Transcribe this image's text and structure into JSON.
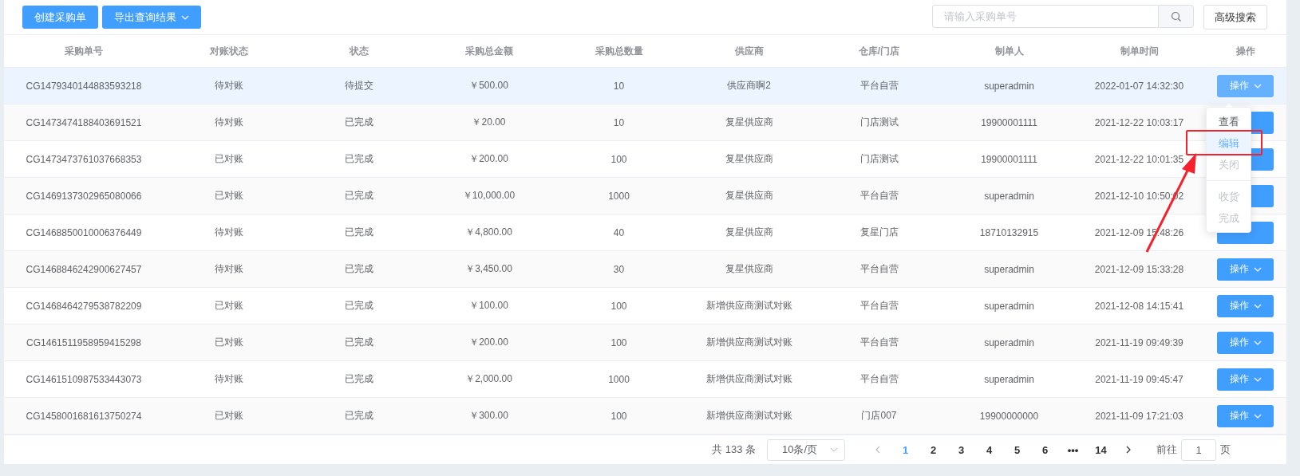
{
  "toolbar": {
    "buttons": [
      {
        "label": "创建采购单",
        "kind": "plain"
      },
      {
        "label": "导出查询结果",
        "kind": "dropdown"
      }
    ],
    "search": {
      "placeholder": "请输入采购单号"
    },
    "advanced_button": "高级搜索"
  },
  "table": {
    "columns": [
      "采购单号",
      "对账状态",
      "状态",
      "采购总金额",
      "采购总数量",
      "供应商",
      "仓库/门店",
      "制单人",
      "制单时间",
      "操作"
    ],
    "rows": [
      {
        "cells": [
          "CG1479340144883593218",
          "待对账",
          "待提交",
          "￥500.00",
          "10",
          "供应商啊2",
          "平台自营",
          "superadmin",
          "2022-01-07 14:32:30"
        ],
        "action": "操作",
        "selected": true
      },
      {
        "cells": [
          "CG1473474188403691521",
          "待对账",
          "已完成",
          "￥20.00",
          "10",
          "复星供应商",
          "门店测试",
          "19900001111",
          "2021-12-22 10:03:17"
        ],
        "selected": false
      },
      {
        "cells": [
          "CG1473473761037668353",
          "已对账",
          "已完成",
          "￥200.00",
          "100",
          "复星供应商",
          "门店测试",
          "19900001111",
          "2021-12-22 10:01:35"
        ],
        "selected": false
      },
      {
        "cells": [
          "CG1469137302965080066",
          "已对账",
          "已完成",
          "￥10,000.00",
          "1000",
          "复星供应商",
          "平台自营",
          "superadmin",
          "2021-12-10 10:50:02"
        ],
        "selected": false
      },
      {
        "cells": [
          "CG1468850010006376449",
          "待对账",
          "已完成",
          "￥4,800.00",
          "40",
          "复星供应商",
          "复星门店",
          "18710132915",
          "2021-12-09 15:48:26"
        ],
        "selected": false
      },
      {
        "cells": [
          "CG1468846242900627457",
          "待对账",
          "已完成",
          "￥3,450.00",
          "30",
          "复星供应商",
          "平台自营",
          "superadmin",
          "2021-12-09 15:33:28"
        ],
        "action": "操作",
        "selected": false
      },
      {
        "cells": [
          "CG1468464279538782209",
          "已对账",
          "已完成",
          "￥100.00",
          "100",
          "新增供应商测试对账",
          "平台自营",
          "superadmin",
          "2021-12-08 14:15:41"
        ],
        "action": "操作",
        "selected": false
      },
      {
        "cells": [
          "CG1461511958959415298",
          "已对账",
          "已完成",
          "￥200.00",
          "100",
          "新增供应商测试对账",
          "平台自营",
          "superadmin",
          "2021-11-19 09:49:39"
        ],
        "action": "操作",
        "selected": false
      },
      {
        "cells": [
          "CG1461510987533443073",
          "待对账",
          "已完成",
          "￥2,000.00",
          "1000",
          "新增供应商测试对账",
          "平台自营",
          "superadmin",
          "2021-11-19 09:45:47"
        ],
        "action": "操作",
        "selected": false
      },
      {
        "cells": [
          "CG1458001681613750274",
          "已对账",
          "已完成",
          "￥300.00",
          "100",
          "新增供应商测试对账",
          "门店007",
          "19900000000",
          "2021-11-09 17:21:03"
        ],
        "action": "操作",
        "selected": false
      }
    ]
  },
  "action_menu": {
    "items": [
      {
        "label": "查看",
        "disabled": false,
        "hovered": false,
        "divided": false
      },
      {
        "label": "编辑",
        "disabled": false,
        "hovered": true,
        "divided": false
      },
      {
        "label": "关闭",
        "disabled": true,
        "hovered": false,
        "divided": false
      },
      {
        "label": "收货",
        "disabled": true,
        "hovered": false,
        "divided": true
      },
      {
        "label": "完成",
        "disabled": true,
        "hovered": false,
        "divided": false
      }
    ]
  },
  "pagination": {
    "total": "共 133 条",
    "page_size": "10条/页",
    "pages": [
      {
        "label": "1",
        "selected": true
      },
      {
        "label": "2",
        "selected": false
      },
      {
        "label": "3",
        "selected": false
      },
      {
        "label": "4",
        "selected": false
      },
      {
        "label": "5",
        "selected": false
      },
      {
        "label": "6",
        "selected": false
      },
      {
        "label": "•••",
        "selected": false
      },
      {
        "label": "14",
        "selected": false
      }
    ],
    "goto_label": "前往",
    "goto_value": "1",
    "goto_unit": "页"
  }
}
